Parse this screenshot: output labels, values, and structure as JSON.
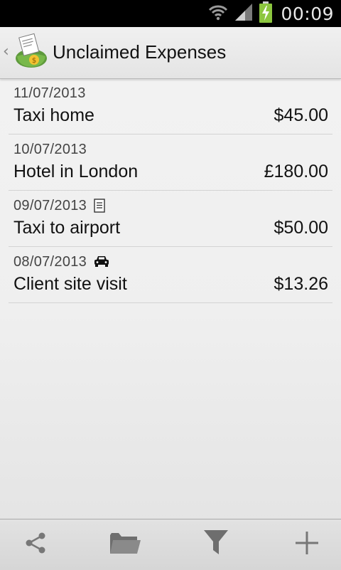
{
  "status_bar": {
    "time": "00:09",
    "icons": [
      "wifi-icon",
      "signal-icon",
      "battery-charging-icon"
    ]
  },
  "action_bar": {
    "title": "Unclaimed Expenses",
    "up_icon": "chevron-left-icon",
    "logo_icon": "wallet-receipt-logo-icon"
  },
  "expenses": [
    {
      "date": "11/07/2013",
      "title": "Taxi home",
      "amount": "$45.00",
      "icon": null
    },
    {
      "date": "10/07/2013",
      "title": "Hotel in London",
      "amount": "£180.00",
      "icon": null
    },
    {
      "date": "09/07/2013",
      "title": "Taxi to airport",
      "amount": "$50.00",
      "icon": "receipt-icon"
    },
    {
      "date": "08/07/2013",
      "title": "Client site visit",
      "amount": "$13.26",
      "icon": "car-icon"
    }
  ],
  "bottom_bar": {
    "buttons": [
      "share-icon",
      "folder-icon",
      "filter-icon",
      "add-icon"
    ]
  },
  "colors": {
    "status_bar_bg": "#000000",
    "battery_accent": "#8cc63f",
    "logo_green": "#6aa84f",
    "text_primary": "#111111",
    "divider": "#d3d3d3"
  }
}
